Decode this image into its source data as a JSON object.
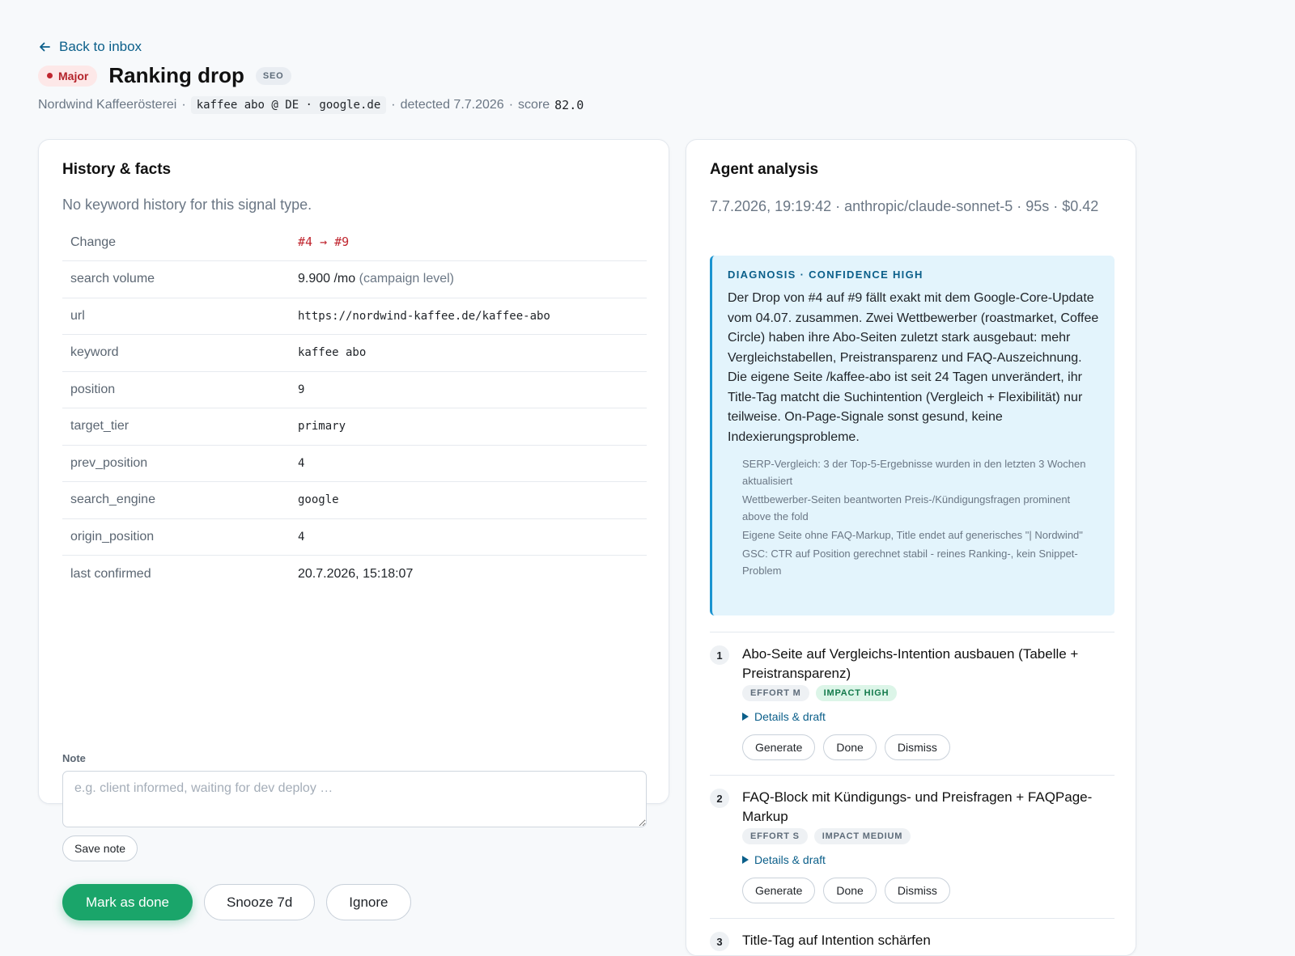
{
  "nav": {
    "back_label": "Back to inbox"
  },
  "header": {
    "severity": "Major",
    "title": "Ranking drop",
    "category": "SEO",
    "client": "Nordwind Kaffeerösterei",
    "keyword_chip": "kaffee abo @ DE · google.de",
    "detected": "detected 7.7.2026",
    "score_label": "score",
    "score": "82.0"
  },
  "history": {
    "title": "History & facts",
    "empty_note": "No keyword history for this signal type.",
    "facts": [
      {
        "key": "Change",
        "value": "#4 → #9"
      },
      {
        "key": "search volume",
        "value": "9.900 /mo",
        "suffix": "(campaign level)"
      },
      {
        "key": "url",
        "value": "https://nordwind-kaffee.de/kaffee-abo"
      },
      {
        "key": "keyword",
        "value": "kaffee abo"
      },
      {
        "key": "position",
        "value": "9"
      },
      {
        "key": "target_tier",
        "value": "primary"
      },
      {
        "key": "prev_position",
        "value": "4"
      },
      {
        "key": "search_engine",
        "value": "google"
      },
      {
        "key": "origin_position",
        "value": "4"
      },
      {
        "key": "last confirmed",
        "value": "20.7.2026, 15:18:07"
      }
    ],
    "note_label": "Note",
    "note_placeholder": "e.g. client informed, waiting for dev deploy …",
    "save_note": "Save note",
    "actions": {
      "done": "Mark as done",
      "snooze": "Snooze 7d",
      "ignore": "Ignore"
    }
  },
  "analysis": {
    "title": "Agent analysis",
    "meta": "7.7.2026, 19:19:42 · anthropic/claude-sonnet-5 · 95s · $0.42",
    "diagnosis_head": "DIAGNOSIS · CONFIDENCE HIGH",
    "diagnosis_text": "Der Drop von #4 auf #9 fällt exakt mit dem Google-Core-Update vom 04.07. zusammen. Zwei Wettbewerber (roastmarket, Coffee Circle) haben ihre Abo-Seiten zuletzt stark ausgebaut: mehr Vergleichstabellen, Preistransparenz und FAQ-Auszeichnung. Die eigene Seite /kaffee-abo ist seit 24 Tagen unverändert, ihr Title-Tag matcht die Suchintention (Vergleich + Flexibilität) nur teilweise. On-Page-Signale sonst gesund, keine Indexierungsprobleme.",
    "evidence": [
      "SERP-Vergleich: 3 der Top-5-Ergebnisse wurden in den letzten 3 Wochen aktualisiert",
      "Wettbewerber-Seiten beantworten Preis-/Kündigungsfragen prominent above the fold",
      "Eigene Seite ohne FAQ-Markup, Title endet auf generisches \"| Nordwind\"",
      "GSC: CTR auf Position gerechnet stabil - reines Ranking-, kein Snippet-Problem"
    ],
    "recommendations": [
      {
        "num": "1",
        "title": "Abo-Seite auf Vergleichs-Intention ausbauen (Tabelle + Preistransparenz)",
        "effort": "EFFORT M",
        "impact": "IMPACT HIGH"
      },
      {
        "num": "2",
        "title": "FAQ-Block mit Kündigungs- und Preisfragen + FAQPage-Markup",
        "effort": "EFFORT S",
        "impact": "IMPACT MEDIUM"
      },
      {
        "num": "3",
        "title": "Title-Tag auf Intention schärfen"
      }
    ],
    "details_label": "Details & draft",
    "generate": "Generate",
    "done": "Done",
    "dismiss": "Dismiss"
  },
  "colors": {
    "accent": "#0b5f8a",
    "primary_button": "#1aa56a",
    "severity": "#c0262f",
    "diagnosis_bg": "#e3f4fc"
  }
}
